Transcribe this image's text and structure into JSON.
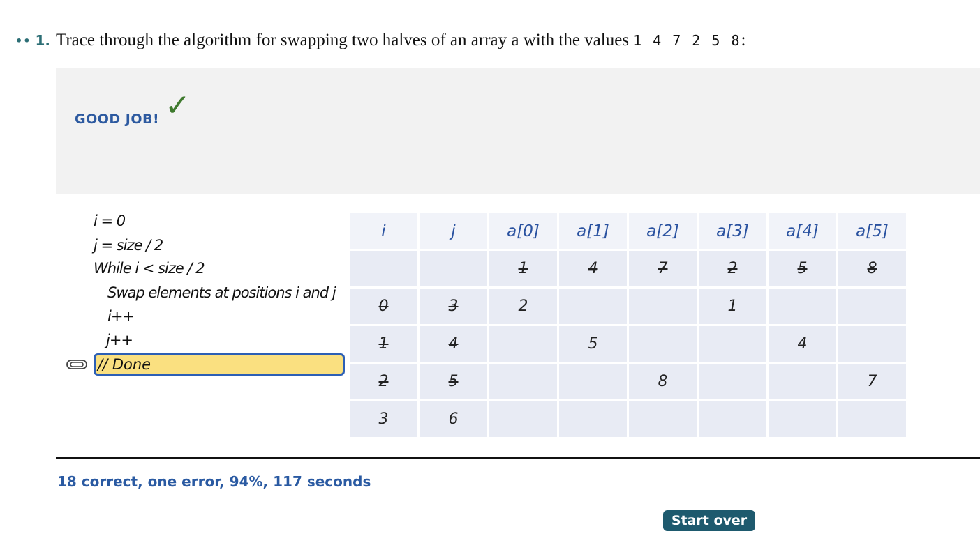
{
  "question": {
    "dots": "••",
    "number": "1.",
    "text": "Trace through the algorithm for swapping two halves of an array a with the values",
    "values": "1 4 7 2 5 8",
    "colon": ":"
  },
  "feedback": {
    "message": "GOOD JOB!",
    "check_glyph": "✓",
    "check_color": "#3f7a2e"
  },
  "pseudocode": {
    "lines": [
      "i = 0",
      "j = size / 2",
      "While i < size / 2",
      "Swap elements at positions i and j",
      "i++",
      "j++",
      "// Done"
    ],
    "active_line": 6
  },
  "trace_table": {
    "headers": [
      "i",
      "j",
      "a[0]",
      "a[1]",
      "a[2]",
      "a[3]",
      "a[4]",
      "a[5]"
    ],
    "rows": [
      [
        {
          "v": ""
        },
        {
          "v": ""
        },
        {
          "v": "1",
          "s": true
        },
        {
          "v": "4",
          "s": true
        },
        {
          "v": "7",
          "s": true
        },
        {
          "v": "2",
          "s": true
        },
        {
          "v": "5",
          "s": true
        },
        {
          "v": "8",
          "s": true
        }
      ],
      [
        {
          "v": "0",
          "s": true
        },
        {
          "v": "3",
          "s": true
        },
        {
          "v": "2"
        },
        {
          "v": ""
        },
        {
          "v": ""
        },
        {
          "v": "1"
        },
        {
          "v": ""
        },
        {
          "v": ""
        }
      ],
      [
        {
          "v": "1",
          "s": true
        },
        {
          "v": "4",
          "s": true
        },
        {
          "v": ""
        },
        {
          "v": "5"
        },
        {
          "v": ""
        },
        {
          "v": ""
        },
        {
          "v": "4"
        },
        {
          "v": ""
        }
      ],
      [
        {
          "v": "2",
          "s": true
        },
        {
          "v": "5",
          "s": true
        },
        {
          "v": ""
        },
        {
          "v": ""
        },
        {
          "v": "8"
        },
        {
          "v": ""
        },
        {
          "v": ""
        },
        {
          "v": "7"
        }
      ],
      [
        {
          "v": "3"
        },
        {
          "v": "6"
        },
        {
          "v": ""
        },
        {
          "v": ""
        },
        {
          "v": ""
        },
        {
          "v": ""
        },
        {
          "v": ""
        },
        {
          "v": ""
        }
      ]
    ]
  },
  "result": {
    "summary": "18 correct, one error, 94%, 117 seconds"
  },
  "actions": {
    "start_over_label": "Start over"
  },
  "colors": {
    "accent": "#2a5aa0",
    "button": "#1e5a6e",
    "highlight": "#fae080"
  }
}
